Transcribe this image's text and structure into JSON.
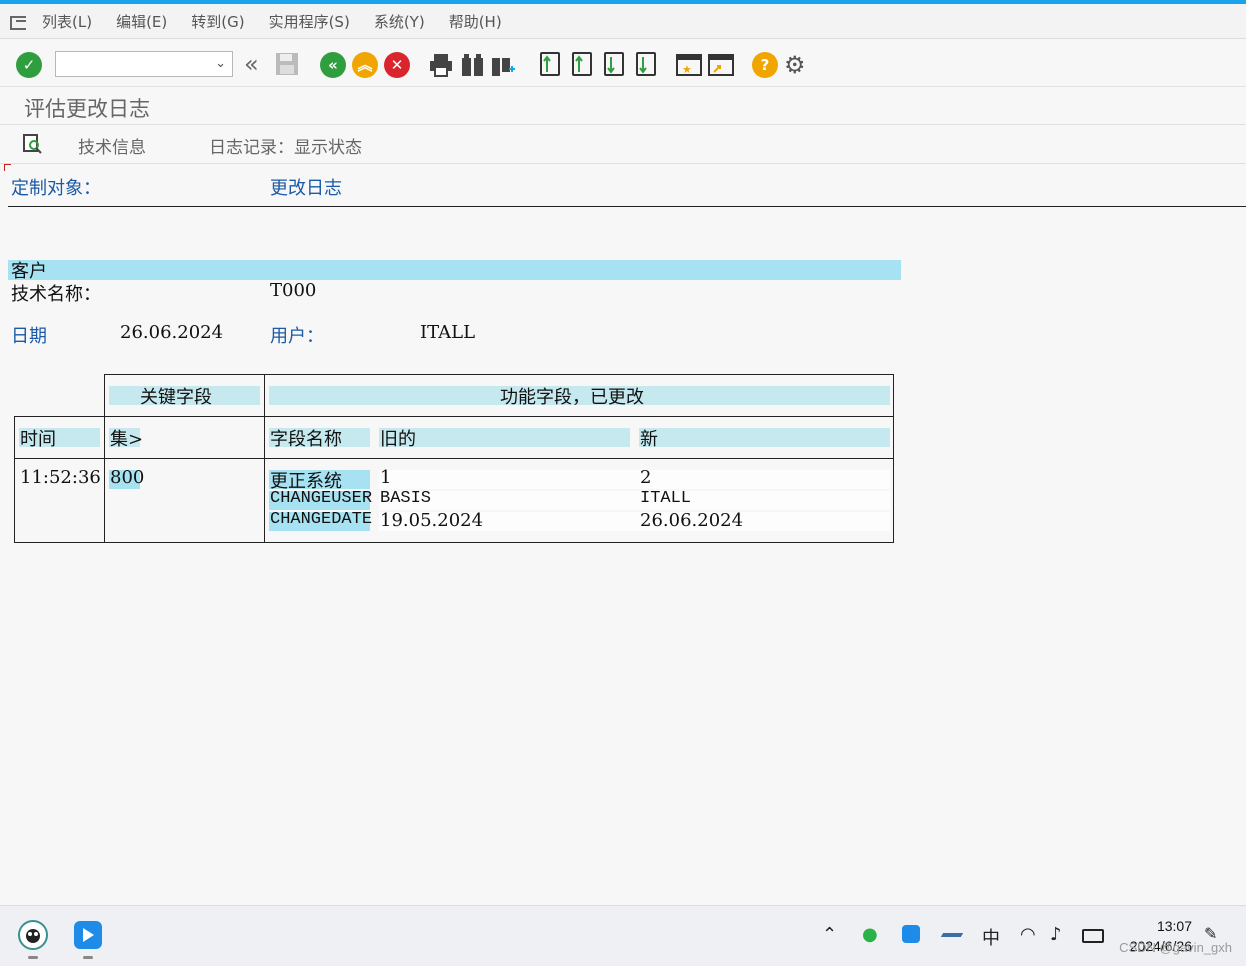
{
  "menu": [
    "列表(L)",
    "编辑(E)",
    "转到(G)",
    "实用程序(S)",
    "系统(Y)",
    "帮助(H)"
  ],
  "toolbar": {
    "command_value": "",
    "icons": [
      "enter-icon",
      "back-icon",
      "save-icon",
      "exit-icon",
      "up-icon",
      "cancel-icon",
      "print-icon",
      "find-icon",
      "find-next-icon",
      "first-page-icon",
      "prev-page-icon",
      "next-page-icon",
      "last-page-icon",
      "create-session-icon",
      "shortcut-icon",
      "help-icon",
      "settings-icon"
    ]
  },
  "screen_title": "评估更改日志",
  "app_toolbar": {
    "tech_info": "技术信息",
    "log_status": "日志记录：显示状态"
  },
  "header": {
    "object_label": "定制对象：",
    "object_value": "更改日志"
  },
  "section": {
    "title": "客户",
    "tech_name_label": "技术名称：",
    "tech_name_value": "T000"
  },
  "meta": {
    "date_label": "日期",
    "date_value": "26.06.2024",
    "user_label": "用户：",
    "user_value": "ITALL"
  },
  "table": {
    "key_header": "关键字段",
    "func_header": "功能字段，已更改",
    "col_time": "时间",
    "col_set": "集>",
    "col_field": "字段名称",
    "col_old": "旧的",
    "col_new": "新",
    "time": "11:52:36",
    "set": "800",
    "rows": [
      {
        "field": "更正系统",
        "old": "1",
        "new": "2"
      },
      {
        "field": "CHANGEUSER",
        "old": "BASIS",
        "new": "ITALL"
      },
      {
        "field": "CHANGEDATE",
        "old": "19.05.2024",
        "new": "26.06.2024"
      }
    ]
  },
  "taskbar": {
    "ime": "中",
    "time": "13:07",
    "date": "2024/6/26",
    "watermark": "CSDN @gavin_gxh"
  },
  "colors": {
    "accent": "#1aa3e8",
    "header_bg": "#c6e9ef",
    "highlight": "#a7e2f2",
    "label_blue": "#1a5aa8"
  }
}
